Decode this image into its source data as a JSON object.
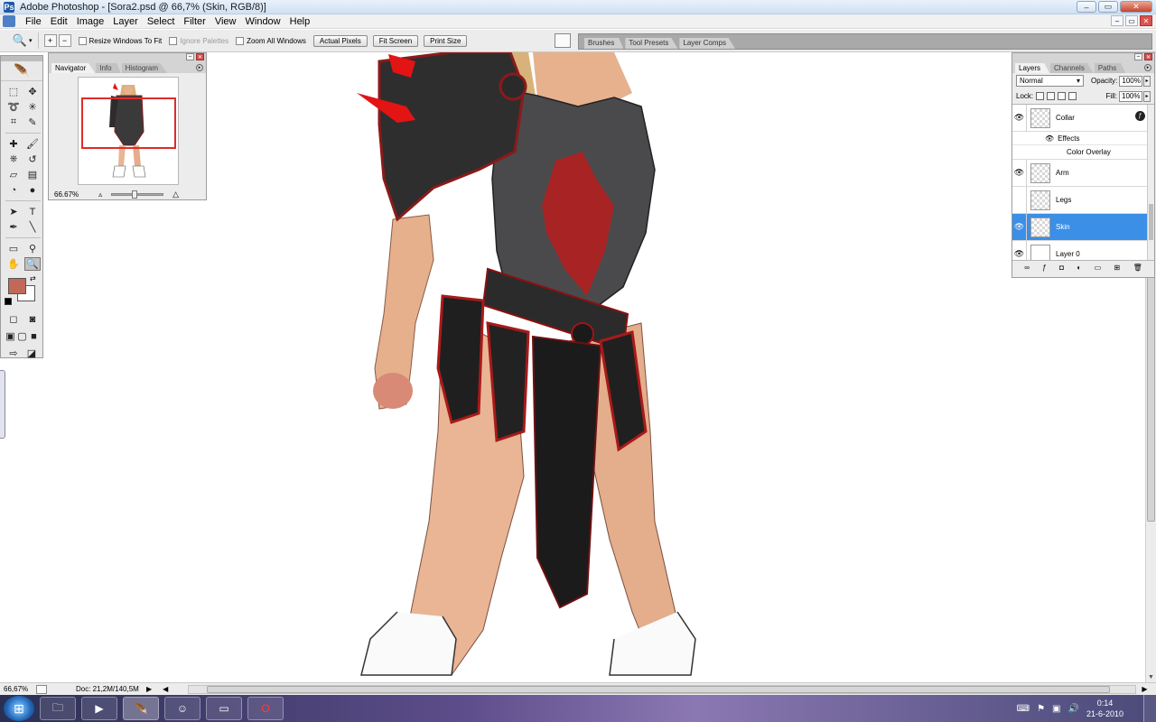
{
  "app": {
    "title": "Adobe Photoshop - [Sora2.psd @ 66,7% (Skin, RGB/8)]"
  },
  "window_controls": {
    "minimize": "–",
    "restore": "▭",
    "close": "✕"
  },
  "menu": {
    "items": [
      "File",
      "Edit",
      "Image",
      "Layer",
      "Select",
      "Filter",
      "View",
      "Window",
      "Help"
    ]
  },
  "options_bar": {
    "zoom_in": "+",
    "zoom_out": "−",
    "checkboxes": [
      {
        "label": "Resize Windows To Fit",
        "checked": false,
        "enabled": true
      },
      {
        "label": "Ignore Palettes",
        "checked": false,
        "enabled": false
      },
      {
        "label": "Zoom All Windows",
        "checked": false,
        "enabled": true
      }
    ],
    "buttons": [
      "Actual Pixels",
      "Fit Screen",
      "Print Size"
    ],
    "palette_well_tabs": [
      "Brushes",
      "Tool Presets",
      "Layer Comps"
    ]
  },
  "navigator": {
    "tabs": [
      "Navigator",
      "Info",
      "Histogram"
    ],
    "zoom": "66.67%"
  },
  "layers_panel": {
    "tabs": [
      "Layers",
      "Channels",
      "Paths"
    ],
    "blend_mode": "Normal",
    "opacity_label": "Opacity:",
    "opacity": "100%",
    "lock_label": "Lock:",
    "fill_label": "Fill:",
    "fill": "100%",
    "effects_label": "Effects",
    "effect_item": "Color Overlay",
    "layers": [
      {
        "name": "Collar",
        "visible": true,
        "selected": false,
        "has_effects": true
      },
      {
        "name": "Arm",
        "visible": true,
        "selected": false,
        "has_effects": false
      },
      {
        "name": "Legs",
        "visible": false,
        "selected": false,
        "has_effects": false
      },
      {
        "name": "Skin",
        "visible": true,
        "selected": true,
        "has_effects": false
      },
      {
        "name": "Layer 0",
        "visible": true,
        "selected": false,
        "has_effects": false
      }
    ]
  },
  "status_bar": {
    "zoom": "66,67%",
    "doc_info": "Doc: 21,2M/140,5M"
  },
  "toolbox": {
    "foreground_color": "#c0695a",
    "background_color": "#ffffff"
  },
  "taskbar": {
    "apps": [
      "explorer-icon",
      "media-player-icon",
      "photoshop-icon",
      "messenger-icon",
      "window-icon",
      "opera-icon"
    ],
    "time": "0:14",
    "date": "21-6-2010"
  }
}
